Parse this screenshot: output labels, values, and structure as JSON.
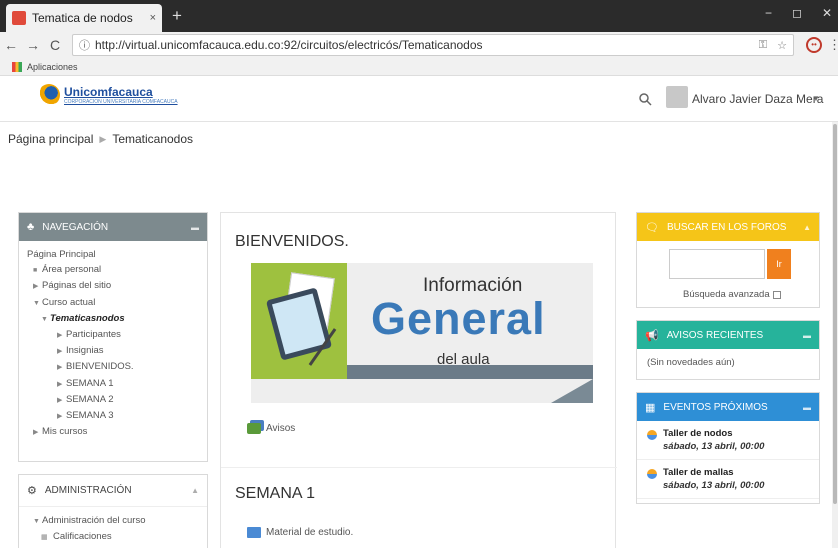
{
  "browser": {
    "tab_title": "Tematica de nodos",
    "tab_close": "×",
    "new_tab": "+",
    "url": "http://virtual.unicomfacauca.edu.co:92/circuitos/electricós/Tematicanodos",
    "bookmark_apps": "Aplicaciones",
    "window_min": "−",
    "window_max": "◻",
    "window_close": "✕"
  },
  "header": {
    "logo_text": "Unicomfacauca",
    "logo_sub": "CORPORACION UNIVERSITARIA COMFACAUCA",
    "user_name": "Alvaro Javier Daza Mera"
  },
  "breadcrumb": {
    "home": "Página principal",
    "current": "Tematicanodos"
  },
  "navigation": {
    "title": "NAVEGACIÓN",
    "items": {
      "home": "Página Principal",
      "personal": "Área personal",
      "site_pages": "Páginas del sitio",
      "current_course": "Curso actual",
      "course": "Tematicasnodos",
      "participants": "Participantes",
      "badges": "Insignias",
      "welcome": "BIENVENIDOS.",
      "week1": "SEMANA 1",
      "week2": "SEMANA 2",
      "week3": "SEMANA 3",
      "my_courses": "Mis cursos"
    }
  },
  "administration": {
    "title": "ADMINISTRACIÓN",
    "course_admin": "Administración del curso",
    "grades": "Calificaciones"
  },
  "main": {
    "welcome_title": "BIENVENIDOS.",
    "banner": {
      "line1": "Información",
      "line2": "General",
      "line3": "del aula"
    },
    "forum_link": "Avisos",
    "week_title": "SEMANA 1",
    "material_link": "Material de estudio."
  },
  "blocks": {
    "search_forums": {
      "title": "BUSCAR EN LOS FOROS",
      "go": "Ir",
      "advanced": "Búsqueda avanzada"
    },
    "news": {
      "title": "AVISOS RECIENTES",
      "empty": "(Sin novedades aún)"
    },
    "events": {
      "title": "EVENTOS PRÓXIMOS",
      "items": [
        {
          "title": "Taller de nodos",
          "date": "sábado, 13 abril, 00:00"
        },
        {
          "title": "Taller de mallas",
          "date": "sábado, 13 abril, 00:00"
        }
      ]
    }
  },
  "colors": {
    "nav_header": "#7d8a8e",
    "search_header": "#f5c518",
    "news_header": "#26b39b",
    "events_header": "#2e8fd6",
    "banner_blue": "#3a79b8",
    "banner_green": "#9ec13f"
  }
}
